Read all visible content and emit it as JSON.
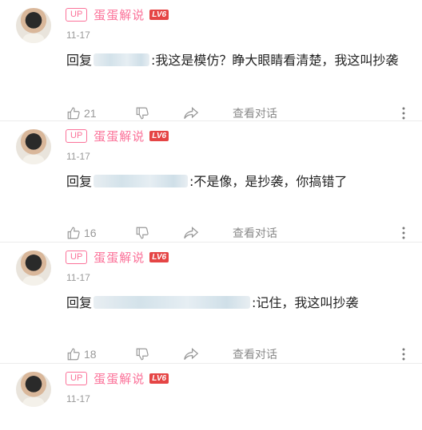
{
  "comments": [
    {
      "badge": "UP",
      "username": "蛋蛋解说",
      "level": "LV6",
      "date": "11-17",
      "reply_prefix": "回复",
      "text": ":我这是模仿？睁大眼睛看清楚，我这叫抄袭",
      "likes": "21",
      "view_label": "查看对话"
    },
    {
      "badge": "UP",
      "username": "蛋蛋解说",
      "level": "LV6",
      "date": "11-17",
      "reply_prefix": "回复",
      "text": ":不是像，是抄袭，你搞错了",
      "likes": "16",
      "view_label": "查看对话"
    },
    {
      "badge": "UP",
      "username": "蛋蛋解说",
      "level": "LV6",
      "date": "11-17",
      "reply_prefix": "回复",
      "text": ":记住，我这叫抄袭",
      "likes": "18",
      "view_label": "查看对话"
    },
    {
      "badge": "UP",
      "username": "蛋蛋解说",
      "level": "LV6",
      "date": "11-17"
    }
  ],
  "colors": {
    "accent": "#fb7299",
    "level": "#e54545",
    "muted": "#999999"
  },
  "icons": [
    "thumbs-up-icon",
    "thumbs-down-icon",
    "share-icon",
    "more-vertical-icon"
  ]
}
